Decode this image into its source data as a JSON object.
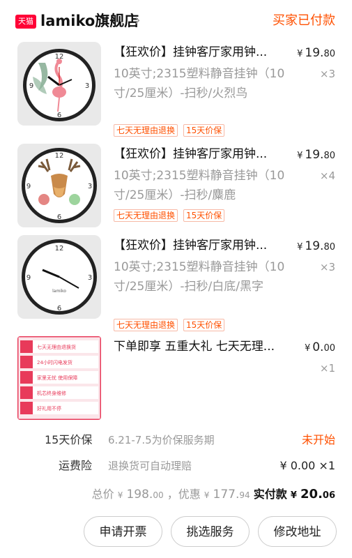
{
  "store": {
    "badge": "天猫",
    "name": "lamiko旗舰店",
    "chevron": "›",
    "status": "买家已付款"
  },
  "items": [
    {
      "title": "【狂欢价】挂钟客厅家用钟...",
      "price_currency": "¥",
      "price_int": "19.",
      "price_dec": "80",
      "qty": "×3",
      "spec": "10英寸;2315塑料静音挂钟（10寸/25厘米）-扫秒/火烈鸟",
      "tags": [
        "七天无理由退换",
        "15天价保"
      ],
      "thumb_icon": "flamingo-clock-image"
    },
    {
      "title": "【狂欢价】挂钟客厅家用钟...",
      "price_currency": "¥",
      "price_int": "19.",
      "price_dec": "80",
      "qty": "×4",
      "spec": "10英寸;2315塑料静音挂钟（10寸/25厘米）-扫秒/麋鹿",
      "tags": [
        "七天无理由退换",
        "15天价保"
      ],
      "thumb_icon": "deer-clock-image"
    },
    {
      "title": "【狂欢价】挂钟客厅家用钟...",
      "price_currency": "¥",
      "price_int": "19.",
      "price_dec": "80",
      "qty": "×3",
      "spec": "10英寸;2315塑料静音挂钟（10寸/25厘米）-扫秒/白底/黑字",
      "tags": [
        "七天无理由退换",
        "15天价保"
      ],
      "thumb_icon": "plain-clock-image"
    },
    {
      "title": "下单即享 五重大礼 七天无理...",
      "price_currency": "¥",
      "price_int": "0.",
      "price_dec": "00",
      "qty": "×1",
      "spec": "",
      "tags": [],
      "thumb_icon": "gift-list-image",
      "thumb_rows": [
        "七天无理由退换货",
        "24小时闪电发货",
        "家里无忧 使用保障",
        "机芯终身维修",
        "好礼用不停"
      ]
    }
  ],
  "price_protection": {
    "label": "15天价保",
    "period": "6.21-7.5为价保服务期",
    "status": "未开始"
  },
  "shipping_insurance": {
    "label": "运费险",
    "desc": "退换货可自动理赔",
    "amount": "¥ 0.00 ×1"
  },
  "totals": {
    "total_label": "总价",
    "total_cur": "¥",
    "total_int": "198.",
    "total_dec": "00",
    "discount_label": "，优惠",
    "discount_cur": "¥",
    "discount_int": "177.",
    "discount_dec": "94",
    "paid_label": "实付款",
    "paid_cur": "¥",
    "paid_int": "20.",
    "paid_dec": "06"
  },
  "actions": {
    "invoice": "申请开票",
    "select_service": "挑选服务",
    "change_address": "修改地址"
  },
  "colors": {
    "accent": "#ff5000",
    "tmall_red": "#ff0036",
    "muted": "#999999"
  }
}
